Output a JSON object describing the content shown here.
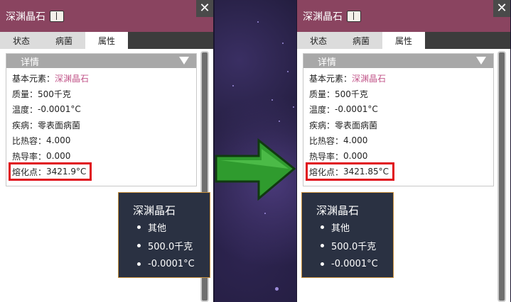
{
  "panels": [
    {
      "title": "深渊晶石",
      "close_label": "✕",
      "tabs": [
        "状态",
        "病菌",
        "属性"
      ],
      "active_tab": 2,
      "details_header": "详情",
      "rows": [
        {
          "label": "基本元素：",
          "value": "深渊晶石"
        },
        {
          "label": "质量：",
          "value": "500千克"
        },
        {
          "label": "温度：",
          "value": "-0.0001°C"
        },
        {
          "label": "疾病：",
          "value": "零表面病菌"
        },
        {
          "label": "比热容：",
          "value": "4.000"
        },
        {
          "label": "热导率：",
          "value": "0.000"
        },
        {
          "label": "熔化点：",
          "value": "3421.9°C"
        }
      ],
      "tooltip": {
        "title": "深渊晶石",
        "items": [
          "其他",
          "500.0千克",
          "-0.0001°C"
        ]
      }
    },
    {
      "title": "深渊晶石",
      "close_label": "✕",
      "tabs": [
        "状态",
        "病菌",
        "属性"
      ],
      "active_tab": 2,
      "details_header": "详情",
      "rows": [
        {
          "label": "基本元素：",
          "value": "深渊晶石"
        },
        {
          "label": "质量：",
          "value": "500千克"
        },
        {
          "label": "温度：",
          "value": "-0.0001°C"
        },
        {
          "label": "疾病：",
          "value": "零表面病菌"
        },
        {
          "label": "比热容：",
          "value": "4.000"
        },
        {
          "label": "热导率：",
          "value": "0.000"
        },
        {
          "label": "熔化点：",
          "value": "3421.85°C"
        }
      ],
      "tooltip": {
        "title": "深渊晶石",
        "items": [
          "其他",
          "500.0千克",
          "-0.0001°C"
        ]
      }
    }
  ],
  "colors": {
    "titlebar": "#8a4460",
    "highlight": "#e0101a",
    "link": "#c2568a",
    "arrow": "#2f9b2e"
  },
  "icons": {
    "title_icon": "book-icon",
    "close": "close-icon",
    "collapse": "triangle-down-icon",
    "arrow": "right-arrow-icon"
  }
}
